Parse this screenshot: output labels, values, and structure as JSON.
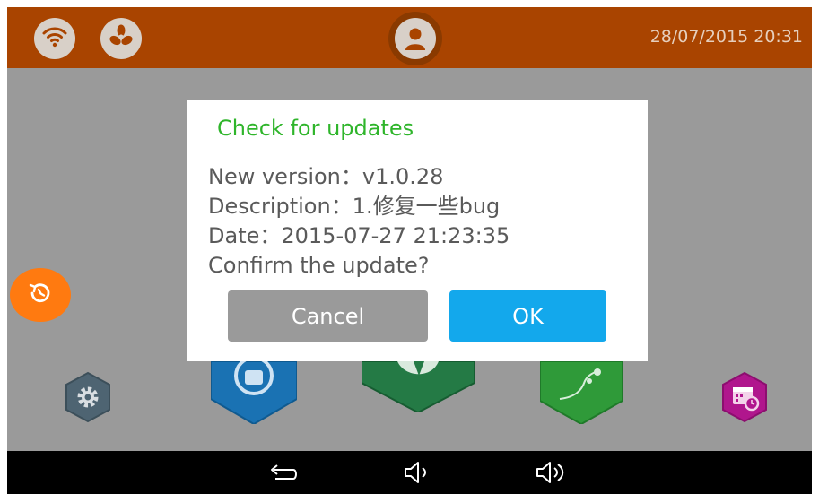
{
  "status_bar": {
    "datetime": "28/07/2015 20:31",
    "icons": [
      "wifi-icon",
      "fan-icon",
      "user-avatar-icon"
    ]
  },
  "side": {
    "history_icon": "history-icon"
  },
  "app_tiles": [
    {
      "name": "settings",
      "icon": "gear-icon",
      "color": "#4e6472"
    },
    {
      "name": "android",
      "icon": "android-icon",
      "color": "#1a72b3"
    },
    {
      "name": "globe",
      "icon": "globe-icon",
      "color": "#247a45"
    },
    {
      "name": "plant",
      "icon": "plant-icon",
      "color": "#2f9a39"
    },
    {
      "name": "schedule",
      "icon": "calendar-clock-icon",
      "color": "#b0168d"
    }
  ],
  "dialog": {
    "title": "Check for updates",
    "lines": [
      "New version：v1.0.28",
      "Description：1.修复一些bug",
      "Date：2015-07-27 21:23:35",
      "Confirm the update?"
    ],
    "cancel_label": "Cancel",
    "ok_label": "OK"
  },
  "nav_bar": {
    "icons": [
      "back-icon",
      "volume-down-icon",
      "volume-up-icon"
    ]
  },
  "colors": {
    "top_bar": "#a94400",
    "dialog_title": "#2fb52b",
    "ok_button": "#13a8ec",
    "cancel_button": "#9a9a9a",
    "history_button": "#ff7a10"
  }
}
